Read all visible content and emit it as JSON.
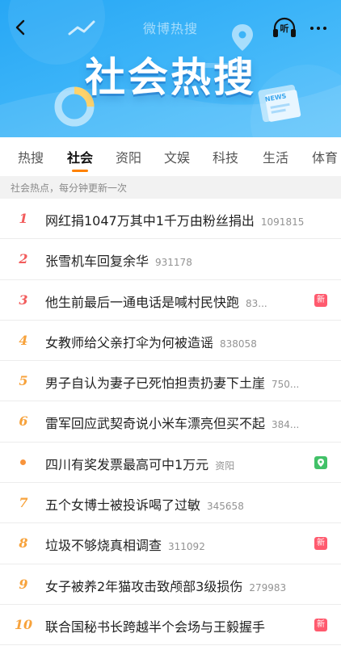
{
  "header": {
    "title": "微博热搜",
    "listen_label": "听",
    "banner_title": "社会热搜"
  },
  "tabs": [
    "热搜",
    "社会",
    "资阳",
    "文娱",
    "科技",
    "生活",
    "体育"
  ],
  "active_tab": "社会",
  "info": "社会热点，每分钟更新一次",
  "colors": {
    "accent": "#ff8200",
    "rank_top": "#f25c5c",
    "rank_mid": "#f28a1e",
    "rank_low": "#f7a23b",
    "badge_new": "#ff5a6e",
    "badge_local": "#42c168"
  },
  "items": [
    {
      "rank": "1",
      "title": "网红捐1047万其中1千万由粉丝捐出",
      "count": "1091815",
      "badge": ""
    },
    {
      "rank": "2",
      "title": "张雪机车回复余华",
      "count": "931178",
      "badge": ""
    },
    {
      "rank": "3",
      "title": "他生前最后一通电话是喊村民快跑",
      "count": "83...",
      "badge": "新"
    },
    {
      "rank": "4",
      "title": "女教师给父亲打伞为何被造谣",
      "count": "838058",
      "badge": ""
    },
    {
      "rank": "5",
      "title": "男子自认为妻子已死怕担责扔妻下土崖",
      "count": "750...",
      "badge": ""
    },
    {
      "rank": "6",
      "title": "雷军回应武契奇说小米车漂亮但买不起",
      "count": "384...",
      "badge": ""
    },
    {
      "rank": "",
      "title": "四川有奖发票最高可中1万元",
      "count": "资阳",
      "badge": "location-pin-icon"
    },
    {
      "rank": "7",
      "title": "五个女博士被投诉喝了过敏",
      "count": "345658",
      "badge": ""
    },
    {
      "rank": "8",
      "title": "垃圾不够烧真相调查",
      "count": "311092",
      "badge": "新"
    },
    {
      "rank": "9",
      "title": "女子被养2年猫攻击致颅部3级损伤",
      "count": "279983",
      "badge": ""
    },
    {
      "rank": "10",
      "title": "联合国秘书长跨越半个会场与王毅握手",
      "count": "",
      "badge": "新"
    }
  ]
}
